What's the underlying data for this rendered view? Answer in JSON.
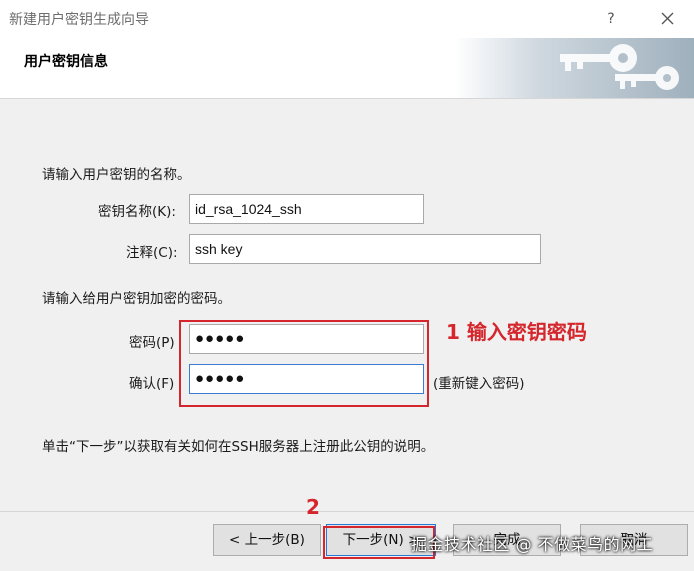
{
  "window": {
    "title": "新建用户密钥生成向导",
    "help_glyph": "?"
  },
  "header": {
    "title": "用户密钥信息"
  },
  "form": {
    "intro_name": "请输入用户密钥的名称。",
    "key_name_label": "密钥名称(K):",
    "key_name_value": "id_rsa_1024_ssh",
    "comment_label": "注释(C):",
    "comment_value": "ssh key",
    "intro_pass": "请输入给用户密钥加密的密码。",
    "password_label": "密码(P)",
    "password_value": "●●●●●",
    "confirm_label": "确认(F)",
    "confirm_value": "●●●●●",
    "reenter_hint": "(重新键入密码)",
    "bottom_note": "单击“下一步”以获取有关如何在SSH服务器上注册此公钥的说明。"
  },
  "annotations": {
    "step1": "1 输入密钥密码",
    "step2": "2"
  },
  "buttons": {
    "back": "< 上一步(B)",
    "next": "下一步(N) >",
    "finish": "完成",
    "cancel": "取消"
  },
  "watermark": "掘金技术社区 @ 不做菜鸟的网工",
  "colors": {
    "annotation_red": "#d4262c",
    "focus_blue": "#3b7bd6",
    "dialog_bg": "#f0f0f0"
  }
}
